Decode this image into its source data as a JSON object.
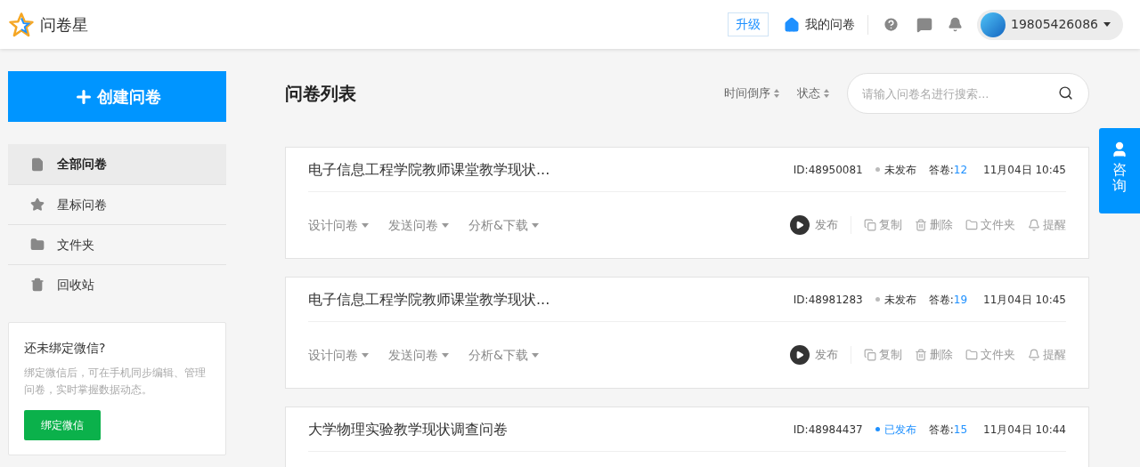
{
  "header": {
    "logo_text": "问卷星",
    "upgrade": "升级",
    "my_surveys": "我的问卷",
    "user": "19805426086"
  },
  "sidebar": {
    "create_button": "创建问卷",
    "items": [
      {
        "label": "全部问卷",
        "selected": true
      },
      {
        "label": "星标问卷",
        "selected": false
      },
      {
        "label": "文件夹",
        "selected": false
      },
      {
        "label": "回收站",
        "selected": false
      }
    ],
    "wechat_card": {
      "title": "还未绑定微信?",
      "text": "绑定微信后，可在手机同步编辑、管理问卷，实时掌握数据动态。",
      "button": "绑定微信"
    }
  },
  "main": {
    "title": "问卷列表",
    "sort_time": "时间倒序",
    "sort_status": "状态",
    "search": {
      "placeholder": "请输入问卷名进行搜索..."
    },
    "surveys": [
      {
        "title": "电子信息工程学院教师课堂教学现状...",
        "id": "ID:48950081",
        "status": "未发布",
        "published": false,
        "answers_label": "答卷:",
        "answers": "12",
        "date": "11月04日 10:45",
        "menus": [
          "设计问卷",
          "发送问卷",
          "分析&下载"
        ],
        "actions": [
          "发布",
          "复制",
          "删除",
          "文件夹",
          "提醒"
        ]
      },
      {
        "title": "电子信息工程学院教师课堂教学现状...",
        "id": "ID:48981283",
        "status": "未发布",
        "published": false,
        "answers_label": "答卷:",
        "answers": "19",
        "date": "11月04日 10:45",
        "menus": [
          "设计问卷",
          "发送问卷",
          "分析&下载"
        ],
        "actions": [
          "发布",
          "复制",
          "删除",
          "文件夹",
          "提醒"
        ]
      },
      {
        "title": "大学物理实验教学现状调查问卷",
        "id": "ID:48984437",
        "status": "已发布",
        "published": true,
        "answers_label": "答卷:",
        "answers": "15",
        "date": "11月04日 10:44"
      }
    ]
  },
  "consult_tab": "咨询"
}
